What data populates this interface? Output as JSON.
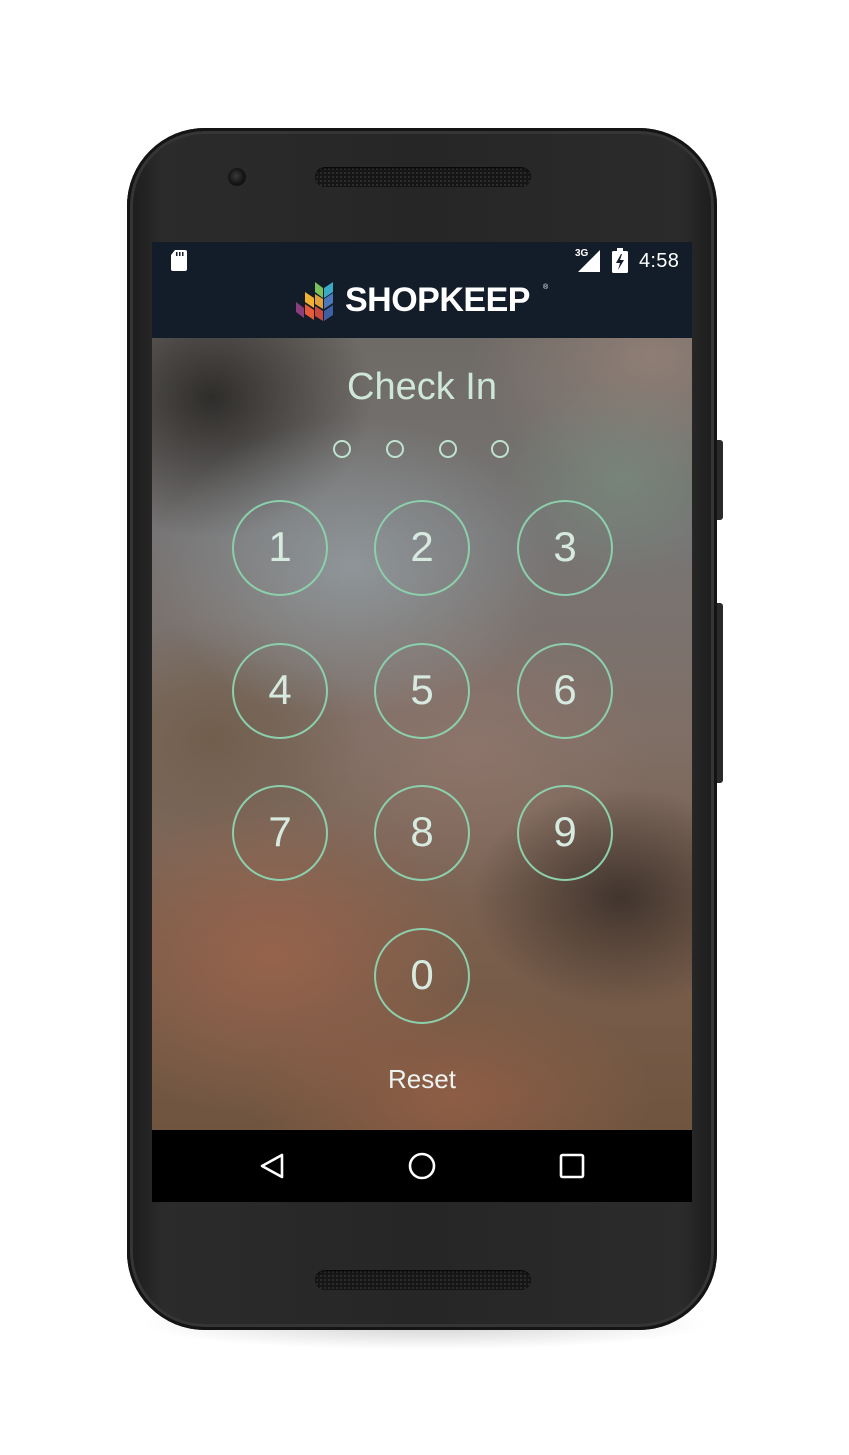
{
  "status_bar": {
    "network": "3G",
    "time": "4:58"
  },
  "header": {
    "brand": "SHOPKEEP",
    "reg_mark": "®",
    "logo_colors": [
      "#7ac15b",
      "#3aa9c6",
      "#4b76b9",
      "#f2b132",
      "#e75b39",
      "#8a3f7c"
    ]
  },
  "checkin": {
    "title": "Check In",
    "pin_length": 4,
    "keys": [
      "1",
      "2",
      "3",
      "4",
      "5",
      "6",
      "7",
      "8",
      "9",
      "0"
    ],
    "reset_label": "Reset"
  },
  "nav": {
    "icons": [
      "back-icon",
      "home-icon",
      "recents-icon"
    ]
  },
  "colors": {
    "key_ring": "#8ccfac",
    "title_text": "#cfe7d8",
    "header_bg": "#131c29"
  }
}
